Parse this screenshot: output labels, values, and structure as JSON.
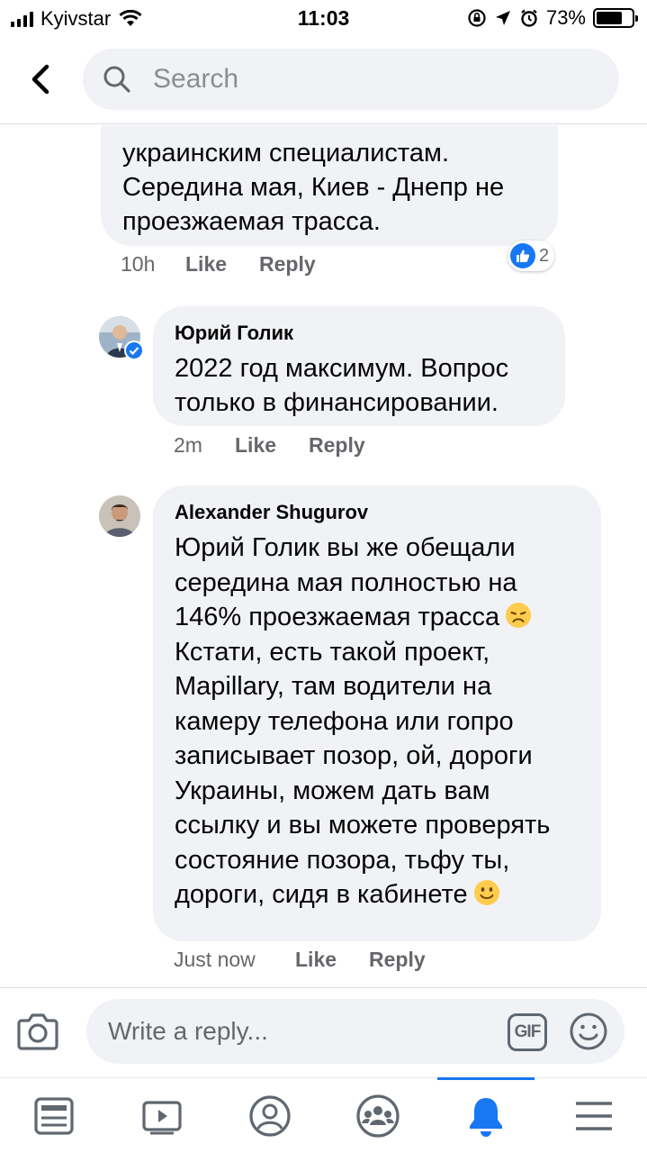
{
  "status_bar": {
    "carrier": "Kyivstar",
    "time": "11:03",
    "battery": "73%",
    "battery_level": 0.73
  },
  "header": {
    "search_placeholder": "Search"
  },
  "comments": [
    {
      "text_lines": [
        "украинским специалистам.",
        "Середина мая, Киев - Днепр не",
        "проезжаемая трасса."
      ],
      "time": "10h",
      "like_label": "Like",
      "reply_label": "Reply",
      "reaction_count": "2"
    },
    {
      "author": "Юрий Голик",
      "text": "2022 год максимум. Вопрос только в финансировании.",
      "time": "2m",
      "like_label": "Like",
      "reply_label": "Reply"
    },
    {
      "author": "Alexander Shugurov",
      "text_part1": "Юрий Голик вы же обещали середина мая полностью на 146% проезжаемая трасса",
      "text_part2": "Кстати, есть такой проект, Mapillary, там водители на камеру телефона или гопро записывает позор, ой, дороги Украины, можем дать вам ссылку и вы можете проверять состояние позора, тьфу ты, дороги, сидя в кабинете",
      "time": "Just now",
      "like_label": "Like",
      "reply_label": "Reply"
    }
  ],
  "composer": {
    "placeholder": "Write a reply...",
    "gif_label": "GIF"
  },
  "tabs": [
    "news-feed",
    "watch",
    "profile",
    "groups",
    "notifications",
    "menu"
  ],
  "colors": {
    "accent": "#1877f2",
    "bubble": "#f0f2f5",
    "meta": "#65676b"
  }
}
